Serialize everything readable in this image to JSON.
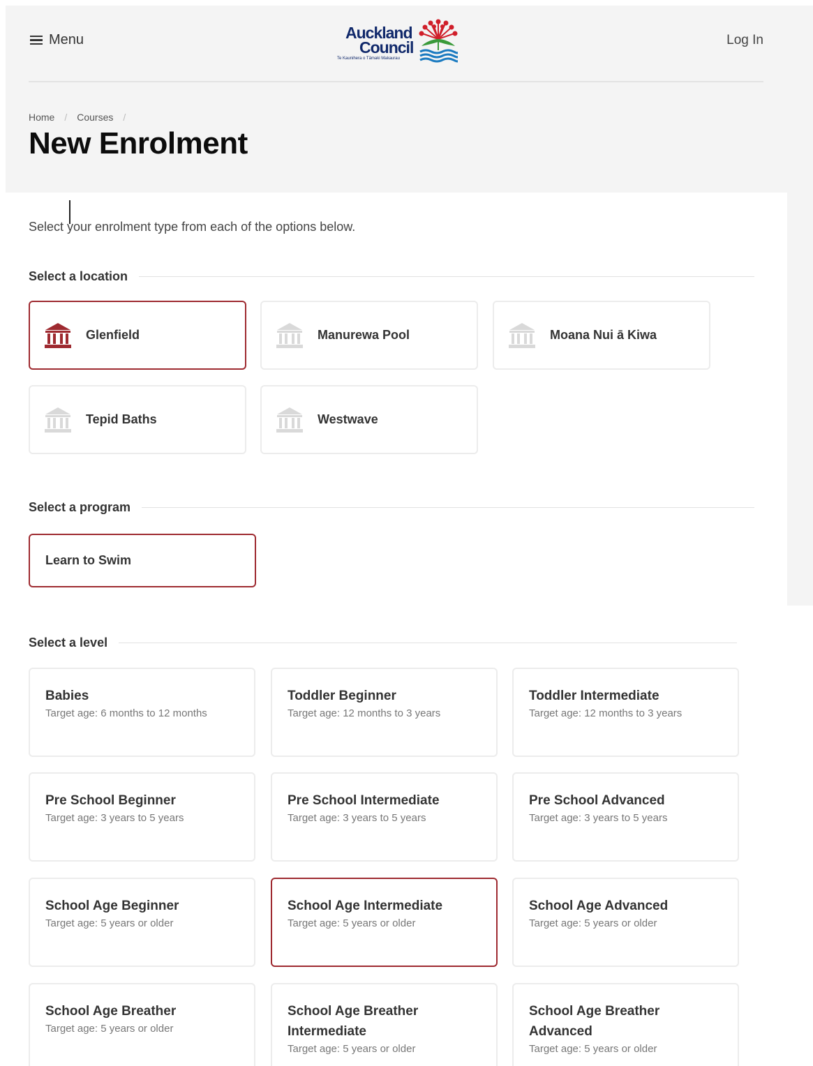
{
  "header": {
    "menu_label": "Menu",
    "logo_line1": "Auckland",
    "logo_line2": "Council",
    "logo_tagline": "Te Kaunihera o Tāmaki Makaurau",
    "login_label": "Log In"
  },
  "breadcrumb": {
    "items": [
      "Home",
      "Courses"
    ]
  },
  "page_title": "New Enrolment",
  "intro_text": "Select your enrolment type from each of the options below.",
  "location_section": {
    "heading": "Select a location",
    "selected": "Glenfield",
    "locations": [
      "Glenfield",
      "Manurewa Pool",
      "Moana Nui ā Kiwa",
      "Tepid Baths",
      "Westwave"
    ]
  },
  "program_section": {
    "heading": "Select a program",
    "programs": [
      "Learn to Swim"
    ],
    "selected": "Learn to Swim"
  },
  "level_section": {
    "heading": "Select a level",
    "selected": "School Age Intermediate",
    "levels": [
      {
        "title": "Babies",
        "age": "Target age: 6 months to 12 months"
      },
      {
        "title": "Toddler Beginner",
        "age": "Target age: 12 months to 3 years"
      },
      {
        "title": "Toddler Intermediate",
        "age": "Target age: 12 months to 3 years"
      },
      {
        "title": "Pre School Beginner",
        "age": "Target age: 3 years to 5 years"
      },
      {
        "title": "Pre School Intermediate",
        "age": "Target age: 3 years to 5 years"
      },
      {
        "title": "Pre School Advanced",
        "age": "Target age: 3 years to 5 years"
      },
      {
        "title": "School Age Beginner",
        "age": "Target age: 5 years or older"
      },
      {
        "title": "School Age Intermediate",
        "age": "Target age: 5 years or older"
      },
      {
        "title": "School Age Advanced",
        "age": "Target age: 5 years or older"
      },
      {
        "title": "School Age Breather",
        "age": "Target age: 5 years or older"
      },
      {
        "title": "School Age Breather Intermediate",
        "age": "Target age: 5 years or older"
      },
      {
        "title": "School Age Breather Advanced",
        "age": "Target age: 5 years or older"
      }
    ]
  },
  "colors": {
    "accent": "#9e2a30",
    "logo_navy": "#11296b",
    "icon_active": "#9e2a30",
    "icon_inactive": "#d9d9d9"
  }
}
